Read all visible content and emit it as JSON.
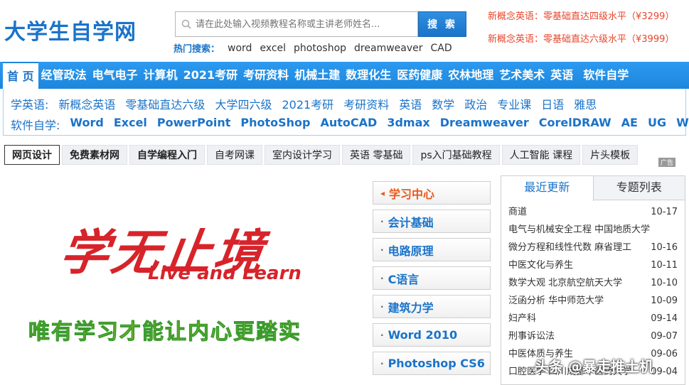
{
  "header": {
    "logo": "大学生自学网",
    "search_placeholder": "请在此处输入视频教程名称或主讲老师姓名...",
    "search_button": "搜 索",
    "hot_label": "热门搜索：",
    "hot_keywords": [
      "word",
      "excel",
      "photoshop",
      "dreamweaver",
      "CAD"
    ],
    "promos": [
      "新概念英语：零基础直达四级水平（¥3299）",
      "新概念英语：零基础直达六级水平（¥3999）"
    ]
  },
  "main_nav": [
    "首 页",
    "经管政法",
    "电气电子",
    "计算机",
    "2021考研",
    "考研资料",
    "机械土建",
    "数理化生",
    "医药健康",
    "农林地理",
    "艺术美术",
    "英语",
    "软件自学"
  ],
  "sub_nav": {
    "row1_label": "学英语:",
    "row1": [
      "新概念英语",
      "零基础直达六级",
      "大学四六级",
      "2021考研",
      "考研资料",
      "英语",
      "数学",
      "政治",
      "专业课",
      "日语",
      "雅思"
    ],
    "row2_label": "软件自学:",
    "row2": [
      "Word",
      "Excel",
      "PowerPoint",
      "PhotoShop",
      "AutoCAD",
      "3dmax",
      "Dreamweaver",
      "CorelDRAW",
      "AE",
      "UG",
      "WPS"
    ]
  },
  "tab_strip": [
    "网页设计",
    "免费素材网",
    "自学编程入门",
    "自考网课",
    "室内设计学习",
    "英语 零基础",
    "ps入门基础教程",
    "人工智能 课程",
    "片头模板"
  ],
  "ad_tag": "广告",
  "banner": {
    "title": "学无止境",
    "subtitle": "Live and Learn",
    "motto": "唯有学习才能让内心更踏实"
  },
  "categories": [
    "学习中心",
    "会计基础",
    "电路原理",
    "C语言",
    "建筑力学",
    "Word 2010",
    "Photoshop CS6"
  ],
  "panel": {
    "tabs": [
      "最近更新",
      "专题列表"
    ],
    "items": [
      {
        "title": "商道",
        "date": "10-17"
      },
      {
        "title": "电气与机械安全工程 中国地质大学",
        "date": ""
      },
      {
        "title": "微分方程和线性代数 麻省理工",
        "date": "10-16"
      },
      {
        "title": "中医文化与养生",
        "date": "10-11"
      },
      {
        "title": "数学大观 北京航空航天大学",
        "date": "10-10"
      },
      {
        "title": "泛函分析 华中师范大学",
        "date": "10-09"
      },
      {
        "title": "妇产科",
        "date": "09-14"
      },
      {
        "title": "刑事诉讼法",
        "date": "09-07"
      },
      {
        "title": "中医体质与养生",
        "date": "09-06"
      },
      {
        "title": "口腔医学 四川成都中医药大学",
        "date": "09-04"
      }
    ]
  },
  "watermark": "头条 @暴走推土机"
}
